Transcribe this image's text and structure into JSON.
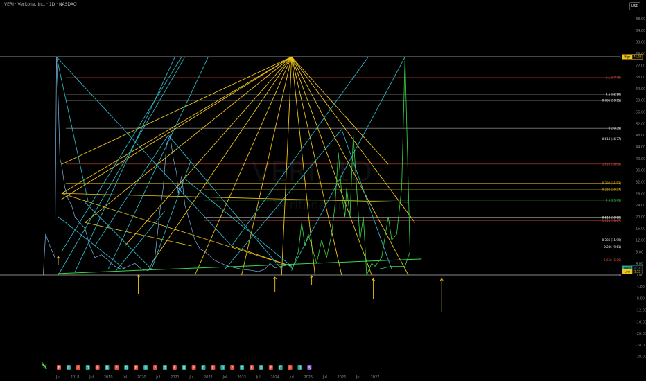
{
  "header": {
    "title": "VERI · Veritone, Inc. · 1D · NASDAQ",
    "currency_button": "USD"
  },
  "watermark": {
    "symbol": "VERI, 1D",
    "name": "Veritone, Inc."
  },
  "colors": {
    "background": "#000000",
    "fan_yellow": "#f2c51a",
    "fan_cyan": "#2db4c2",
    "projection_green": "#3bd84a",
    "price_line": "#7fb6e6",
    "arrow_yellow": "#f2c51a"
  },
  "chart_data": {
    "type": "line",
    "title": "VERI · Veritone, Inc. · 1D · NASDAQ",
    "y_range": [
      -32,
      92
    ],
    "x_range": [
      2017.0,
      2028.6
    ],
    "y_ticks": [
      "88.00",
      "84.00",
      "80.00",
      "76.00",
      "72.00",
      "68.00",
      "64.00",
      "60.00",
      "56.00",
      "52.00",
      "48.00",
      "44.00",
      "40.00",
      "36.00",
      "32.00",
      "28.00",
      "24.00",
      "20.00",
      "16.00",
      "12.00",
      "8.00",
      "4.00",
      "0.00",
      "-4.00",
      "-8.00",
      "-12.00",
      "-16.00",
      "-20.00",
      "-24.00",
      "-28.00"
    ],
    "x_ticks": [
      {
        "label": "Jul",
        "x": 2017.5
      },
      {
        "label": "2018",
        "x": 2018.0
      },
      {
        "label": "Jul",
        "x": 2018.5
      },
      {
        "label": "2019",
        "x": 2019.0
      },
      {
        "label": "Jul",
        "x": 2019.5
      },
      {
        "label": "2020",
        "x": 2020.0
      },
      {
        "label": "Jul",
        "x": 2020.5
      },
      {
        "label": "2021",
        "x": 2021.0
      },
      {
        "label": "Jul",
        "x": 2021.5
      },
      {
        "label": "2022",
        "x": 2022.0
      },
      {
        "label": "Jul",
        "x": 2022.5
      },
      {
        "label": "2023",
        "x": 2023.0
      },
      {
        "label": "Jul",
        "x": 2023.5
      },
      {
        "label": "2024",
        "x": 2024.0
      },
      {
        "label": "Jul",
        "x": 2024.5
      },
      {
        "label": "2025",
        "x": 2025.0
      },
      {
        "label": "Jul",
        "x": 2025.5
      },
      {
        "label": "2026",
        "x": 2026.0
      },
      {
        "label": "Jul",
        "x": 2026.5
      },
      {
        "label": "2027",
        "x": 2027.0
      }
    ],
    "fib_levels": [
      {
        "label": "1",
        "value": 74.92,
        "color": "#d9d9d9"
      },
      {
        "label": "1.1 (67.79)",
        "value": 67.79,
        "color": "#e0523a"
      },
      {
        "label": "0.5 (62.10)",
        "value": 62.1,
        "color": "#ffffff"
      },
      {
        "label": "0.786 (59.95)",
        "value": 59.95,
        "color": "#ffffff"
      },
      {
        "label": "0 (50.39)",
        "value": 50.39,
        "color": "#ffffff"
      },
      {
        "label": "0.618 (46.77)",
        "value": 46.77,
        "color": "#ffffff"
      },
      {
        "label": "1.618 (38.09)",
        "value": 38.09,
        "color": "#e0523a"
      },
      {
        "label": "0.382 (31.53)",
        "value": 31.53,
        "color": "#f2c51a"
      },
      {
        "label": "0.382 (29.27)",
        "value": 29.27,
        "color": "#f2c51a"
      },
      {
        "label": "0.5 (25.71)",
        "value": 25.71,
        "color": "#3bd84a"
      },
      {
        "label": "0.618 (19.80)",
        "value": 19.8,
        "color": "#ffffff"
      },
      {
        "label": "1.618 (18.67)",
        "value": 18.67,
        "color": "#e0523a"
      },
      {
        "label": "0.786 (11.99)",
        "value": 11.99,
        "color": "#ffffff"
      },
      {
        "label": "0.236 (9.61)",
        "value": 9.61,
        "color": "#ffffff"
      },
      {
        "label": "1.618 (5.06)",
        "value": 5.06,
        "color": "#e0523a"
      },
      {
        "label": "0",
        "value": 0.0,
        "color": "#d9d9d9"
      }
    ],
    "price_badges": [
      {
        "label": "High",
        "value": "74.92",
        "price": 74.92,
        "color": "#f2c51a"
      },
      {
        "label": "NOW",
        "value": "2.37",
        "price": 2.37,
        "color": "#26a69a"
      },
      {
        "label": "Low",
        "value": "1.22",
        "price": 1.22,
        "color": "#f2c51a"
      }
    ],
    "series": [
      {
        "points": [
          [
            2017.05,
            0
          ],
          [
            2017.12,
            14
          ],
          [
            2017.25,
            10
          ],
          [
            2017.4,
            6
          ],
          [
            2017.45,
            74.9
          ],
          [
            2017.5,
            60
          ],
          [
            2017.55,
            40
          ],
          [
            2017.6,
            38
          ],
          [
            2017.7,
            30
          ],
          [
            2017.8,
            26
          ],
          [
            2017.9,
            24
          ],
          [
            2018.0,
            20
          ],
          [
            2018.15,
            18
          ],
          [
            2018.3,
            16
          ],
          [
            2018.45,
            10
          ],
          [
            2018.6,
            6
          ],
          [
            2018.8,
            7
          ],
          [
            2019.0,
            5
          ],
          [
            2019.2,
            3
          ],
          [
            2019.4,
            2
          ],
          [
            2019.6,
            3
          ],
          [
            2019.8,
            4
          ],
          [
            2020.0,
            2
          ],
          [
            2020.2,
            1.5
          ],
          [
            2020.4,
            6
          ],
          [
            2020.55,
            22
          ],
          [
            2020.65,
            30
          ],
          [
            2020.75,
            45
          ],
          [
            2020.85,
            48
          ],
          [
            2020.95,
            40
          ],
          [
            2021.05,
            35
          ],
          [
            2021.1,
            28
          ],
          [
            2021.2,
            34
          ],
          [
            2021.3,
            24
          ],
          [
            2021.4,
            20
          ],
          [
            2021.5,
            16
          ],
          [
            2021.6,
            12
          ],
          [
            2021.75,
            9
          ],
          [
            2021.9,
            8
          ],
          [
            2022.0,
            7
          ],
          [
            2022.2,
            5
          ],
          [
            2022.4,
            4
          ],
          [
            2022.6,
            3
          ],
          [
            2022.8,
            2.5
          ],
          [
            2023.0,
            2
          ],
          [
            2023.3,
            1.6
          ],
          [
            2023.5,
            1.2
          ],
          [
            2023.7,
            2
          ],
          [
            2023.85,
            4
          ],
          [
            2024.0,
            2.5
          ],
          [
            2024.2,
            3
          ],
          [
            2024.4,
            3.5
          ],
          [
            2024.5,
            2.37
          ]
        ]
      }
    ]
  },
  "events": [
    "E",
    "D",
    "E",
    "D",
    "E",
    "D",
    "E",
    "D",
    "E",
    "D",
    "E",
    "D",
    "E",
    "D",
    "E",
    "D",
    "E",
    "D",
    "E",
    "D",
    "E",
    "D",
    "E",
    "D",
    "E",
    "D",
    "S"
  ],
  "logo": "🦎"
}
